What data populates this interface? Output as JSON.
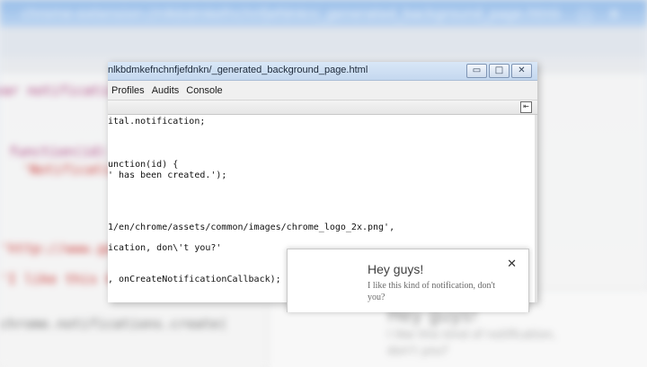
{
  "devtools": {
    "title": "nlkbdmkefnchnfjefdnkn/_generated_background_page.html",
    "window_controls": {
      "minimize": "▭",
      "maximize": "□",
      "close": "✕"
    },
    "menu": [
      {
        "label": "Profiles"
      },
      {
        "label": "Audits"
      },
      {
        "label": "Console"
      }
    ],
    "dock_icon": "dock-to-side-icon",
    "code_lines": [
      {
        "text": "ital.notification;",
        "color": "#111111"
      },
      {
        "text": "unction(id) {",
        "color": "#111111"
      },
      {
        "text": "' has been created.');",
        "color": "#111111"
      },
      {
        "text": "1/en/chrome/assets/common/images/chrome_logo_2x.png',",
        "color": "#111111"
      },
      {
        "text": "ication, don\\'t you?'",
        "color": "#111111"
      },
      {
        "text": ", onCreateNotificationCallback);",
        "color": "#111111"
      }
    ]
  },
  "notification": {
    "title": "Hey guys!",
    "message": "I like this kind of notification, don't you?",
    "close_label": "✕"
  },
  "colors": {
    "titlebar": "#c9dbf0",
    "code_pink": "#c0246b",
    "code_red": "#c41a16"
  }
}
